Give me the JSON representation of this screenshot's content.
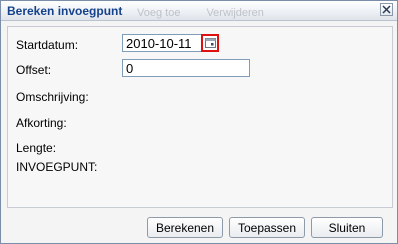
{
  "window": {
    "title": "Bereken invoegpunt",
    "background_toolbar": [
      "Voeg toe",
      "Verwijderen"
    ]
  },
  "form": {
    "startdatum": {
      "label": "Startdatum:",
      "value": "2010-10-11"
    },
    "offset": {
      "label": "Offset:",
      "value": "0"
    },
    "omschrijving": {
      "label": "Omschrijving:"
    },
    "afkorting": {
      "label": "Afkorting:"
    },
    "lengte": {
      "label": "Lengte:"
    },
    "invoegpunt": {
      "label": "INVOEGPUNT:"
    }
  },
  "buttons": {
    "bereken": "Berekenen",
    "toepassen": "Toepassen",
    "sluiten": "Sluiten"
  },
  "icons": {
    "close": "close-icon",
    "calendar": "calendar-icon"
  },
  "colors": {
    "title_text": "#15428b",
    "highlight": "#e01010"
  }
}
